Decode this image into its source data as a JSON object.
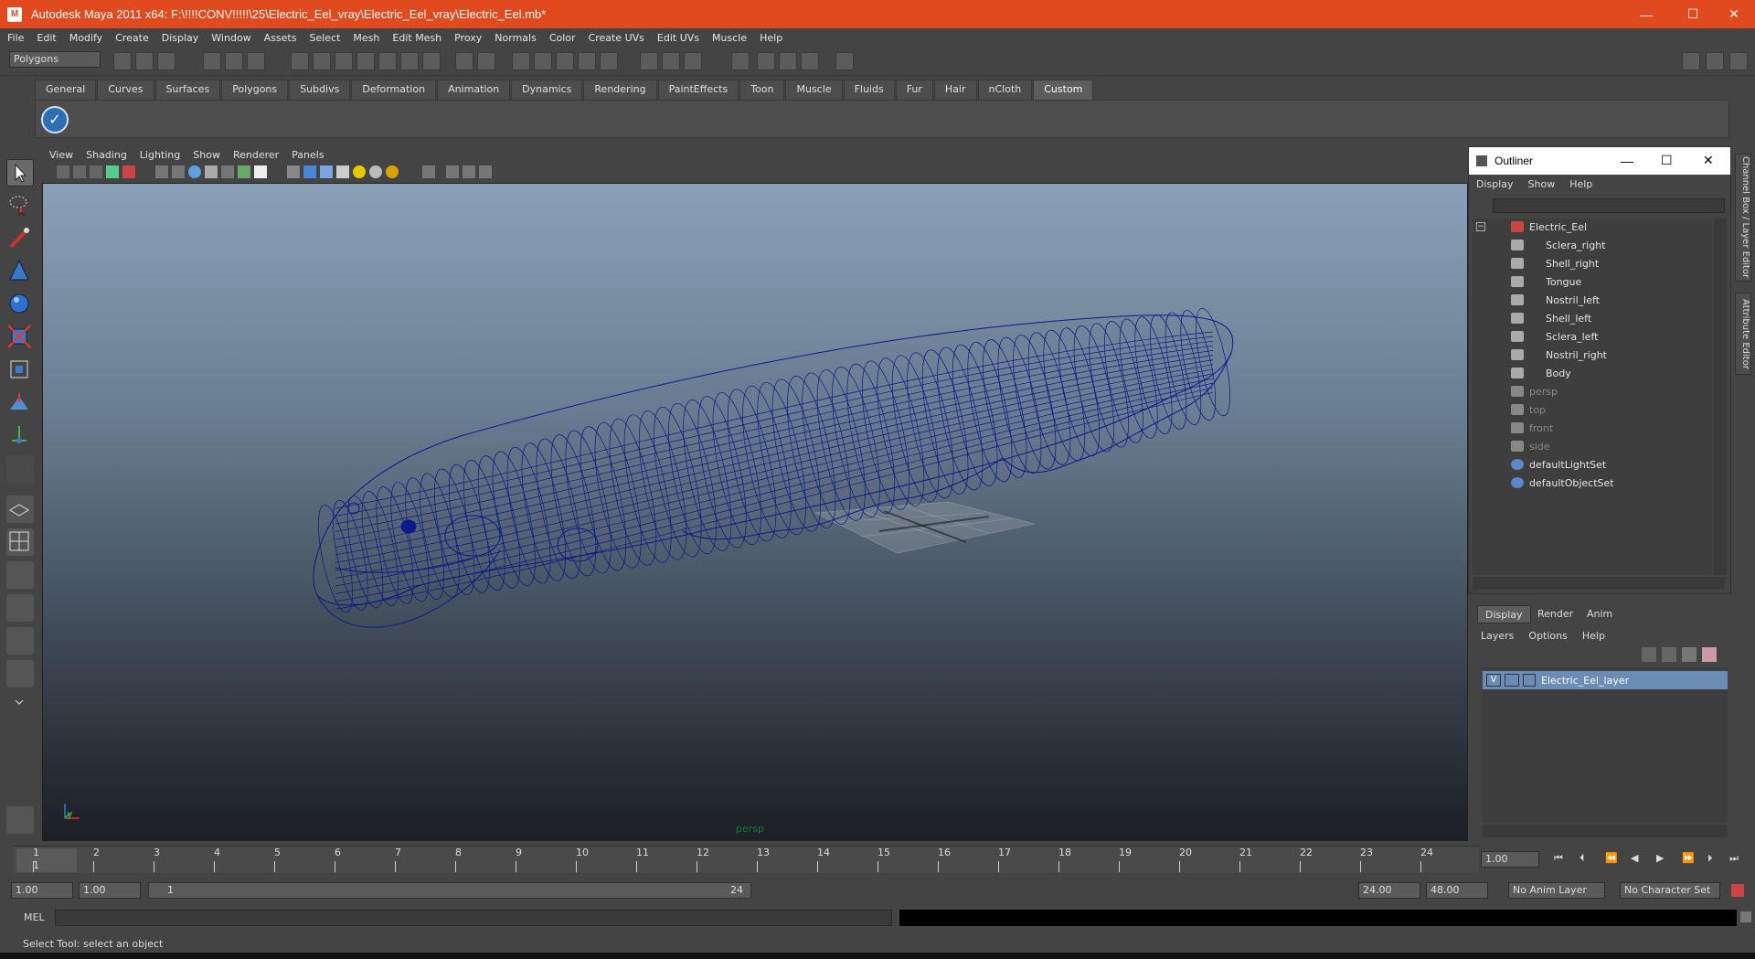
{
  "window": {
    "title": "Autodesk Maya 2011 x64: F:\\!!!!CONV!!!!!\\25\\Electric_Eel_vray\\Electric_Eel_vray\\Electric_Eel.mb*",
    "minimize": "—",
    "maximize": "☐",
    "close": "✕"
  },
  "menubar": [
    "File",
    "Edit",
    "Modify",
    "Create",
    "Display",
    "Window",
    "Assets",
    "Select",
    "Mesh",
    "Edit Mesh",
    "Proxy",
    "Normals",
    "Color",
    "Create UVs",
    "Edit UVs",
    "Muscle",
    "Help"
  ],
  "statusline": {
    "mode": "Polygons"
  },
  "shelf": {
    "tabs": [
      "General",
      "Curves",
      "Surfaces",
      "Polygons",
      "Subdivs",
      "Deformation",
      "Animation",
      "Dynamics",
      "Rendering",
      "PaintEffects",
      "Toon",
      "Muscle",
      "Fluids",
      "Fur",
      "Hair",
      "nCloth",
      "Custom"
    ],
    "active": "Custom"
  },
  "viewport": {
    "menu": [
      "View",
      "Shading",
      "Lighting",
      "Show",
      "Renderer",
      "Panels"
    ],
    "camera_label": "persp",
    "axis_y": "y"
  },
  "outliner": {
    "title": "Outliner",
    "menu": [
      "Display",
      "Show",
      "Help"
    ],
    "items": [
      {
        "label": "Electric_Eel",
        "level": 0,
        "dim": false
      },
      {
        "label": "Sclera_right",
        "level": 1,
        "dim": false
      },
      {
        "label": "Shell_right",
        "level": 1,
        "dim": false
      },
      {
        "label": "Tongue",
        "level": 1,
        "dim": false
      },
      {
        "label": "Nostril_left",
        "level": 1,
        "dim": false
      },
      {
        "label": "Shell_left",
        "level": 1,
        "dim": false
      },
      {
        "label": "Sclera_left",
        "level": 1,
        "dim": false
      },
      {
        "label": "Nostril_right",
        "level": 1,
        "dim": false
      },
      {
        "label": "Body",
        "level": 1,
        "dim": false
      },
      {
        "label": "persp",
        "level": 0,
        "dim": true
      },
      {
        "label": "top",
        "level": 0,
        "dim": true
      },
      {
        "label": "front",
        "level": 0,
        "dim": true
      },
      {
        "label": "side",
        "level": 0,
        "dim": true
      },
      {
        "label": "defaultLightSet",
        "level": 0,
        "dim": false
      },
      {
        "label": "defaultObjectSet",
        "level": 0,
        "dim": false
      }
    ]
  },
  "layer_editor": {
    "tabs": [
      "Display",
      "Render",
      "Anim"
    ],
    "active_tab": "Display",
    "menu": [
      "Layers",
      "Options",
      "Help"
    ],
    "layer": {
      "visible": "V",
      "name": "Electric_Eel_layer"
    }
  },
  "side_tabs": [
    "Channel Box / Layer Editor",
    "Attribute Editor"
  ],
  "timeline": {
    "ticks": [
      "1",
      "2",
      "3",
      "4",
      "5",
      "6",
      "7",
      "8",
      "9",
      "10",
      "11",
      "12",
      "13",
      "14",
      "15",
      "16",
      "17",
      "18",
      "19",
      "20",
      "21",
      "22",
      "23",
      "24"
    ],
    "current_frame": "1",
    "current_time": "1.00"
  },
  "range": {
    "start": "1.00",
    "anim_start": "1.00",
    "range_start": "1",
    "range_end": "24",
    "anim_end": "24.00",
    "end": "48.00",
    "anim_layer": "No Anim Layer",
    "character_set": "No Character Set"
  },
  "command": {
    "label": "MEL"
  },
  "help_line": "Select Tool: select an object",
  "colors": {
    "titlebar": "#e04a1e",
    "wireframe": "#0a1a8a",
    "layer_selected": "#6b8cb5"
  }
}
